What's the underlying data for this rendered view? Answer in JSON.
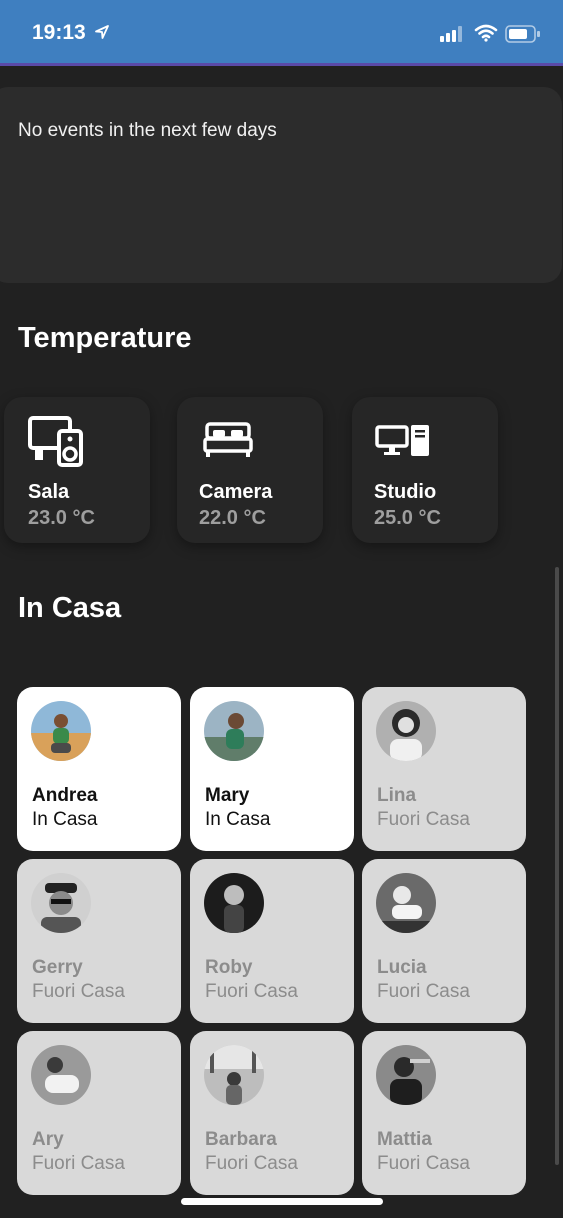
{
  "status_bar": {
    "time": "19:13"
  },
  "events": {
    "empty_text": "No events in the next few days"
  },
  "temperature": {
    "title": "Temperature",
    "rooms": [
      {
        "name": "Sala",
        "value": "23.0 °C",
        "icon": "tv-speaker-icon"
      },
      {
        "name": "Camera",
        "value": "22.0 °C",
        "icon": "bed-icon"
      },
      {
        "name": "Studio",
        "value": "25.0 °C",
        "icon": "desktop-computer-icon"
      }
    ]
  },
  "in_casa": {
    "title": "In Casa",
    "people": [
      {
        "name": "Andrea",
        "status": "In Casa"
      },
      {
        "name": "Mary",
        "status": "In Casa"
      },
      {
        "name": "Lina",
        "status": "Fuori Casa"
      },
      {
        "name": "Gerry",
        "status": "Fuori Casa"
      },
      {
        "name": "Roby",
        "status": "Fuori Casa"
      },
      {
        "name": "Lucia",
        "status": "Fuori Casa"
      },
      {
        "name": "Ary",
        "status": "Fuori Casa"
      },
      {
        "name": "Barbara",
        "status": "Fuori Casa"
      },
      {
        "name": "Mattia",
        "status": "Fuori Casa"
      }
    ]
  },
  "colors": {
    "status_bar": "#3f7fc0",
    "background": "#212121",
    "card": "#2c2c2c",
    "person_home": "#ffffff",
    "person_away": "#d9d9d9"
  }
}
